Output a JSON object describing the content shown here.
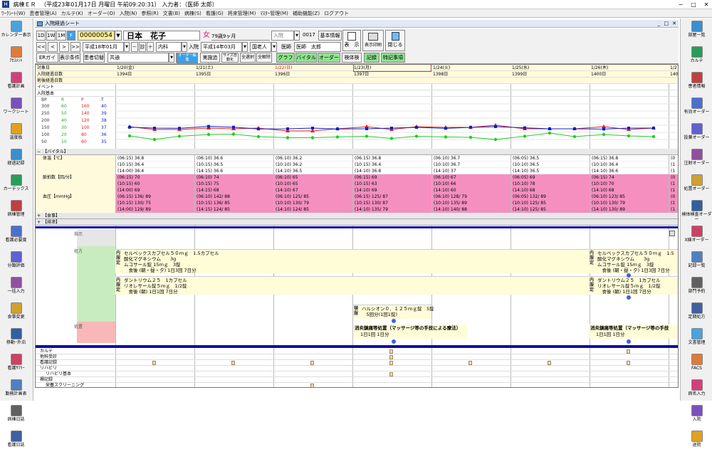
{
  "window": {
    "app_name": "病棟ＥＲ",
    "title_info": "（平成23年01月17日 月曜日 午前09:20:31） 入力者：（医師 太郎）"
  },
  "menu": [
    "ﾜｰｸｼｰﾄ(W)",
    "患者管理(A)",
    "カルテ(K)",
    "オーダー(O)",
    "入院(N)",
    "参照(R)",
    "文書(B)",
    "病棟(S)",
    "看護(G)",
    "将来管理(M)",
    "ﾏｽﾀｰ管理(M)",
    "補助機能(Z)",
    "ログアウト"
  ],
  "left_sidebar": [
    "カレンダー表示",
    "ｱｾｽﾒﾝﾄ",
    "看護計画",
    "ワークシート",
    "温度板",
    "経過記録",
    "カーデックス",
    "病棟管理",
    "看護必要度",
    "分類評価",
    "一括入力",
    "食事変更",
    "移動･外泊",
    "看護ｻﾏﾘｰ",
    "勤務計画表",
    "病棟日誌",
    "看護日誌"
  ],
  "right_sidebar": [
    "部屋一覧",
    "カルテ",
    "患者情報",
    "有効オーダー",
    "投薬オーダー",
    "注射オーダー",
    "処置オーダー",
    "検体検査オーダー",
    "X線オーダー",
    "記録一覧",
    "部門予約",
    "定期処方",
    "文書管理",
    "FACS",
    "病名入力",
    "入院",
    "退院"
  ],
  "inner_window_title": "入院経過シート",
  "toolbar": {
    "range_buttons": [
      "1D",
      "1W",
      "1M",
      "F"
    ],
    "patient_id": "00000054",
    "patient_name": "日本　花子",
    "gender": "女",
    "age": "79歳9ヶ月",
    "status_select": "入院",
    "bed": "0017",
    "basic_info_button": "基本情報",
    "nav_buttons": [
      "<<",
      "<",
      ">",
      ">>"
    ],
    "date_field": "平成18年01月23日",
    "minus": "－",
    "dept_short": "診",
    "plus": "＋",
    "dept": "内科",
    "admit_label": "入院",
    "admit_date": "平成14年03月29日",
    "ward_label": "国老人",
    "doctor_label": "医師",
    "doctor_name": "医師　太郎",
    "display_button": "表　示",
    "display_cond_button": "表示印刷",
    "close_button": "閉じる",
    "row3": [
      "ERガイド",
      "表示条件",
      "患者切替"
    ],
    "common_select": "共通",
    "ellipsis": "…",
    "order_edit": "オーダー編集",
    "impl_add": "実施追加",
    "size_auto": "サイズ自動化",
    "select_all": "全選択",
    "release_all": "全解除",
    "tabs_a": [
      "グラフ",
      "バイタル",
      "オーダー"
    ],
    "sample_check": "検体検査",
    "tabs_b": [
      "記録",
      "特記事項"
    ]
  },
  "grid": {
    "row_labels": [
      "対象日",
      "入院経過日数",
      "術後経過日数",
      "イベント",
      "入院基本"
    ],
    "dates": [
      "1/20(金)",
      "1/21(土)",
      "1/22(日)",
      "1/23(月)",
      "1/24(火)",
      "1/25(水)",
      "1/26(木)",
      "1/27"
    ],
    "day_counts": [
      "1394日",
      "1395日",
      "1396日",
      "1397日",
      "1398日",
      "1399日",
      "1400日",
      "1401"
    ],
    "vital_legend": {
      "headers": [
        "BP",
        "R",
        "P",
        "T"
      ],
      "rows": [
        [
          "300",
          "60",
          "160",
          "40"
        ],
        [
          "250",
          "50",
          "140",
          "39"
        ],
        [
          "200",
          "40",
          "120",
          "38"
        ],
        [
          "150",
          "30",
          "100",
          "37"
        ],
        [
          "100",
          "20",
          "80",
          "36"
        ],
        [
          "50",
          "10",
          "60",
          "35"
        ]
      ]
    },
    "vital_section": "【バイタル】",
    "temp_label": "体温【℃】",
    "pulse_label": "脈拍数【回/分】",
    "bp_label": "血圧【mmHg】",
    "meal_section": "【食事】",
    "excretion_section": "【排泄】",
    "temp": [
      [
        "(06:15) 36.8",
        "(10:15) 36.4",
        "(14:00) 36.4"
      ],
      [
        "(06:10) 36.6",
        "(10:15) 36.5",
        "(14:15) 36.6"
      ],
      [
        "(06:10) 36.2",
        "(10:10) 36.2",
        "(14:10) 36.5"
      ],
      [
        "(06:15) 36.8",
        "(10:15) 36.4",
        "(14:10) 36.8"
      ],
      [
        "(06:10) 36.7",
        "(10:10) 36.7",
        "(14:10) 37"
      ],
      [
        "(06:05) 36.5",
        "(10:10) 36.5",
        "(14:10) 36.5"
      ],
      [
        "(06:15) 36.8",
        "(10:10) 36.4",
        "(14:10) 36.6"
      ],
      [
        "(0",
        "(1",
        "(1"
      ]
    ],
    "pulse": [
      [
        "(06:15) 70",
        "(10:15) 60",
        "(14:00) 69"
      ],
      [
        "(06:10) 74",
        "(10:15) 75",
        "(14:15) 68"
      ],
      [
        "(06:10) 65",
        "(10:10) 65",
        "(14:10) 67"
      ],
      [
        "(06:15) 69",
        "(10:15) 63",
        "(14:10) 69"
      ],
      [
        "(06:10) 67",
        "(10:10) 66",
        "(14:10) 60"
      ],
      [
        "(06:05) 69",
        "(10:10) 78",
        "(14:10) 68"
      ],
      [
        "(06:15) 74",
        "(10:10) 70",
        "(14:10) 68"
      ],
      [
        "(0",
        "(1",
        "(1"
      ]
    ],
    "bp": [
      [
        "(06:15) 136/ 89",
        "(10:15) 130/ 75",
        "(14:00) 129/ 89"
      ],
      [
        "(06:10) 142/ 88",
        "(10:15) 136/ 85",
        "(14:15) 124/ 85"
      ],
      [
        "(06:10) 125/ 85",
        "(10:10) 130/ 79",
        "(14:10) 124/ 85"
      ],
      [
        "(06:15) 125/ 87",
        "(10:15) 130/ 87",
        "(14:10) 135/ 79"
      ],
      [
        "(06:10) 128/ 79",
        "(10:10) 135/ 89",
        "(14:10) 140/ 88"
      ],
      [
        "(06:05) 132/ 89",
        "(10:10) 125/ 85",
        "(14:10) 125/ 85"
      ],
      [
        "(06:10) 123/ 85",
        "(10:10) 130/ 79",
        "(14:10) 130/ 89"
      ],
      [
        "(0",
        "(1",
        "(1"
      ]
    ],
    "order_labels": {
      "instruction": "指示",
      "prescription": "処方",
      "treatment": "処置"
    },
    "rx1": {
      "tag": "内服定",
      "lines": [
        "セルベックスカプセル５０ｍｇ　1.5カプセル",
        "酸化マグネシウム　　3g",
        "ムコサール錠 15ｍｇ　3錠",
        "　食後 (朝・昼・夕) 1日3回 7日分"
      ]
    },
    "rx2": {
      "tag": "内服定",
      "lines": [
        "ダントリウム２５　1カプセル",
        "リオレサール錠５ｍｇ　1/2錠",
        "　食後 (朝) 1日1回 7日分"
      ]
    },
    "rx1_right": {
      "tag": "内服定",
      "lines": [
        "セルベックスカプセル５０ｍｇ　1.5",
        "酸化マグネシウム　　3g",
        "ムコサール錠 15ｍｇ　3錠",
        "　食後 (朝・昼・夕) 1日3回 7日分"
      ]
    },
    "rx2_right": {
      "tag": "内服定",
      "lines": [
        "ダントリウム２５　1カプセル",
        "リオレサール錠５ｍｇ　1/2錠",
        "　食後 (朝) 1日1回 7日分"
      ]
    },
    "rx3": {
      "tag": "頓服",
      "lines": [
        "ハルシオン０．１２５ｍｇ錠　5錠",
        "　5回分(1回1錠)"
      ]
    },
    "treatment1": {
      "name": "消炎鎮痛等処置（マッサージ等の手技による療法）",
      "freq": "1日1回 1日分"
    },
    "treatment2": {
      "name": "消炎鎮痛等処置（マッサージ等の手技",
      "freq": "1日1回 1日分"
    },
    "record_rows": [
      "カルテ",
      "他科受診",
      "看護記録",
      "リハビリ",
      "リハビリ基本",
      "褥記録",
      "栄養スクリーニング",
      "特記事項"
    ]
  },
  "colors": {
    "pink": "#f48fc0",
    "yellow_rx": "#fffcd8",
    "green_tab": "#8de48d",
    "navy_rule": "#1010a0",
    "line_r": "#22cc22",
    "line_p": "#e02020",
    "line_bp": "#1020c0"
  }
}
